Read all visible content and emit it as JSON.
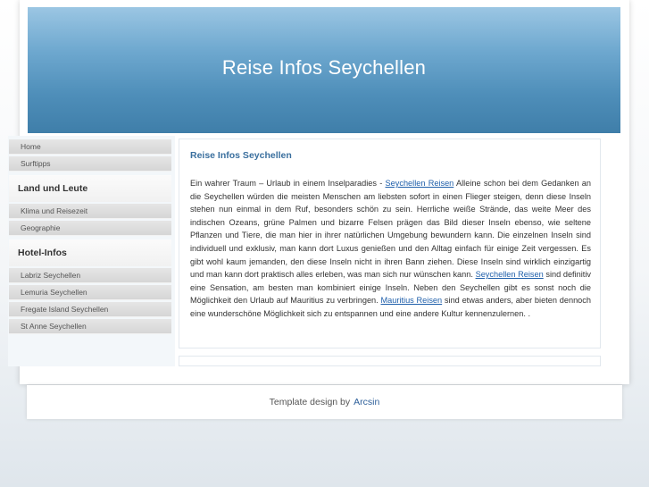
{
  "header": {
    "title": "Reise Infos Seychellen"
  },
  "sidebar": {
    "items": [
      {
        "type": "item",
        "label": "Home"
      },
      {
        "type": "item",
        "label": "Surftipps"
      },
      {
        "type": "group",
        "label": "Land und Leute"
      },
      {
        "type": "item",
        "label": "Klima und Reisezeit"
      },
      {
        "type": "item",
        "label": "Geographie"
      },
      {
        "type": "group",
        "label": "Hotel-Infos"
      },
      {
        "type": "item",
        "label": "Labriz Seychellen"
      },
      {
        "type": "item",
        "label": "Lemuria Seychellen"
      },
      {
        "type": "item",
        "label": "Fregate Island Seychellen"
      },
      {
        "type": "item",
        "label": "St Anne Seychellen"
      }
    ]
  },
  "content": {
    "title": "Reise Infos Seychellen",
    "text_1": "Ein wahrer Traum – Urlaub in einem Inselparadies - ",
    "link_1": "Seychellen Reisen",
    "text_2": " Alleine schon bei dem Gedanken an die Seychellen würden die meisten Menschen am liebsten sofort in einen Flieger steigen, denn diese Inseln stehen nun einmal in dem Ruf, besonders schön zu sein. Herrliche weiße Strände, das weite Meer des indischen Ozeans, grüne Palmen und bizarre Felsen prägen das Bild dieser Inseln ebenso, wie seltene Pflanzen und Tiere, die man hier in ihrer natürlichen Umgebung bewundern kann. Die einzelnen Inseln sind individuell und exklusiv, man kann dort Luxus genießen und den Alltag einfach für einige Zeit vergessen. Es gibt wohl kaum jemanden, den diese Inseln nicht in ihren Bann ziehen. Diese Inseln sind wirklich einzigartig und man kann dort praktisch alles erleben, was man sich nur wünschen kann. ",
    "link_2": "Seychellen Reisen",
    "text_3": " sind definitiv eine Sensation, am besten man kombiniert einige Inseln. Neben den Seychellen gibt es sonst noch die Möglichkeit den Urlaub auf Mauritius zu verbringen. ",
    "link_3": "Mauritius Reisen",
    "text_4": " sind etwas anders, aber bieten dennoch eine wunderschöne Möglichkeit sich zu entspannen und eine andere Kultur kennenzulernen. ."
  },
  "footer": {
    "text": "Template design by",
    "link": "Arcsin"
  }
}
